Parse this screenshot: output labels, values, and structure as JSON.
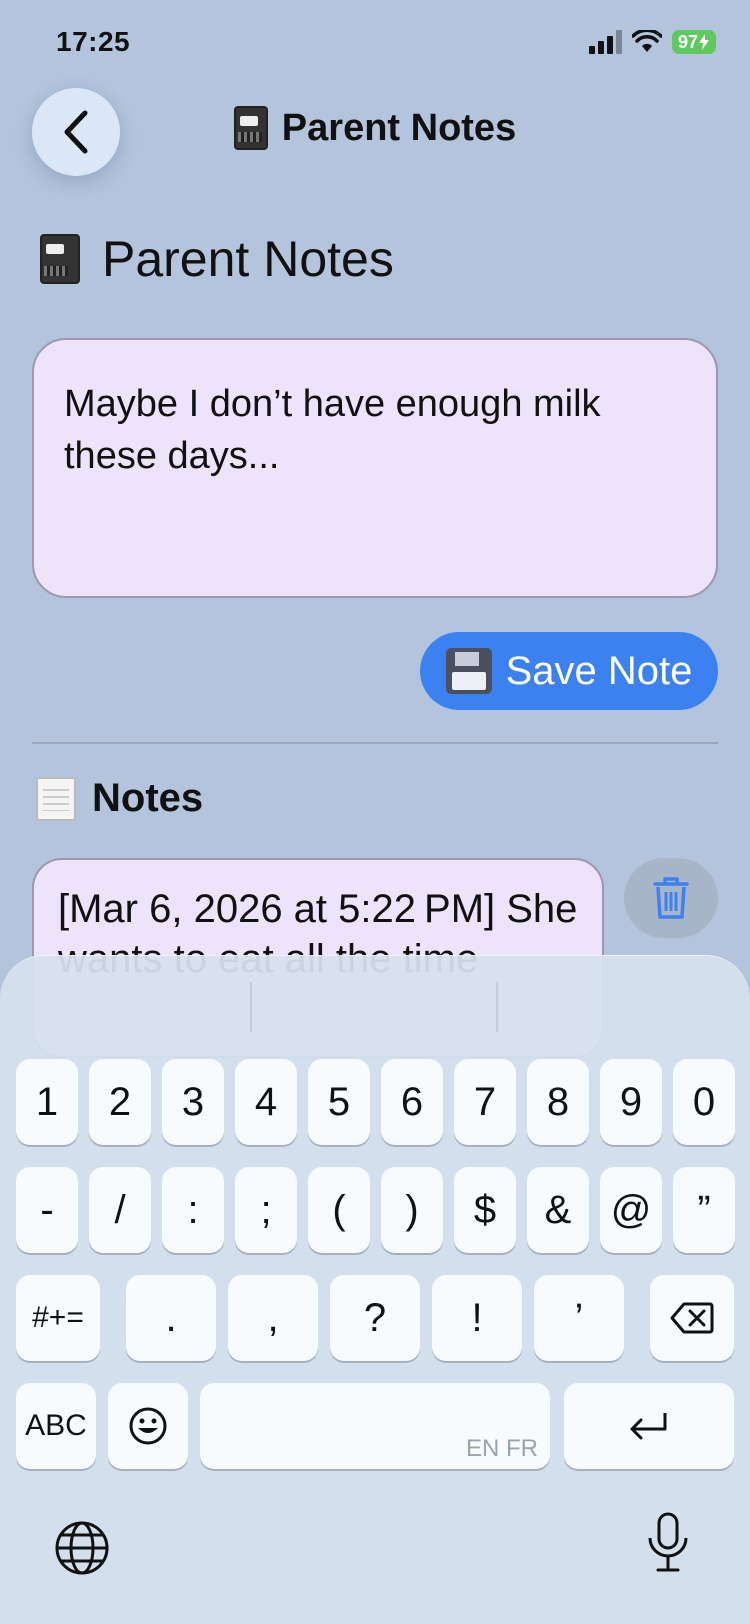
{
  "status": {
    "time": "17:25",
    "battery": "97"
  },
  "nav": {
    "title": "Parent Notes"
  },
  "heading": "Parent Notes",
  "note_input": {
    "value": "Maybe I don’t have enough milk these days..."
  },
  "save_button": {
    "label": "Save Note"
  },
  "notes_section": {
    "title": "Notes"
  },
  "notes": [
    {
      "text": "[Mar 6, 2026 at 5:22 PM] She wants to eat all the time"
    }
  ],
  "keyboard": {
    "row1": [
      "1",
      "2",
      "3",
      "4",
      "5",
      "6",
      "7",
      "8",
      "9",
      "0"
    ],
    "row2": [
      "-",
      "/",
      ":",
      ";",
      "(",
      ")",
      "$",
      "&",
      "@",
      "”"
    ],
    "row3": [
      ".",
      ",",
      "?",
      "!",
      "’"
    ],
    "symbols_key": "#+=",
    "abc_key": "ABC",
    "space_hint": "EN FR"
  },
  "colors": {
    "background": "#b3c4dc",
    "accent": "#3b82f0",
    "card": "#ede3fb"
  },
  "icons": [
    "back-chevron-icon",
    "notebook-icon",
    "floppy-disk-icon",
    "notepad-icon",
    "trash-icon",
    "delete-key-icon",
    "emoji-icon",
    "return-icon",
    "globe-icon",
    "mic-icon"
  ]
}
